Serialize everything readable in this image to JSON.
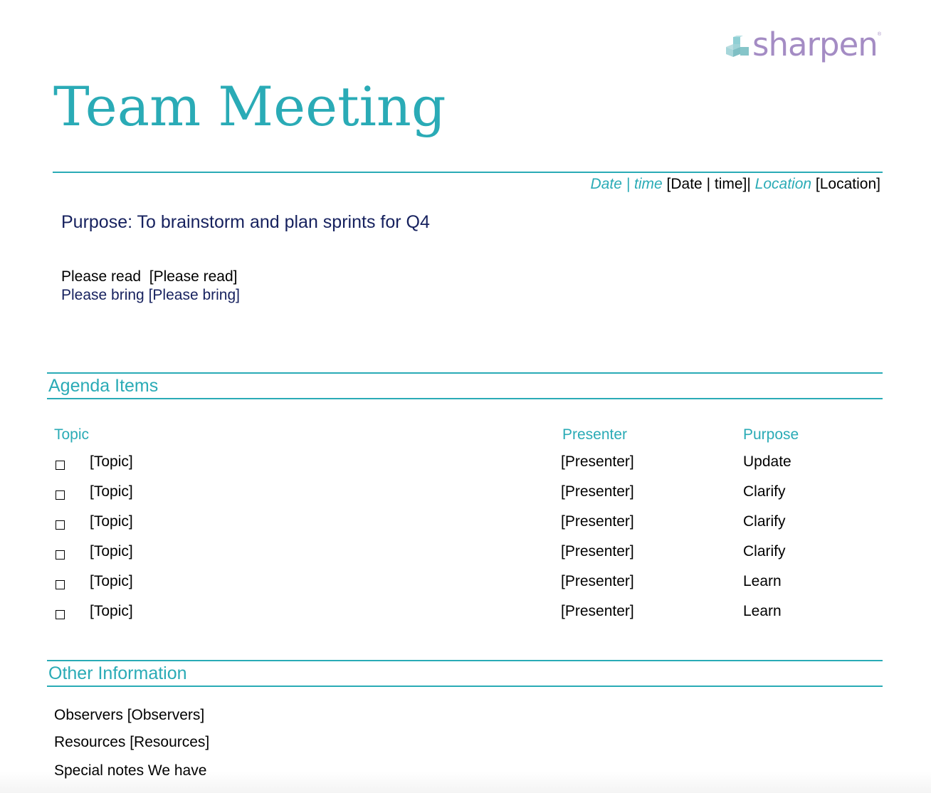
{
  "logo": {
    "name": "sharpen",
    "icon": "stacked-cubes-icon",
    "registered": "®"
  },
  "document": {
    "title": "Team Meeting",
    "meta": {
      "date_label": "Date | time",
      "date_value": "[Date | time]|",
      "location_label": "Location",
      "location_value": "[Location]"
    },
    "purpose": "Purpose: To brainstorm and plan sprints for Q4",
    "please_read": "Please read  [Please read]",
    "please_bring": "Please bring [Please bring]"
  },
  "agenda": {
    "section_title": "Agenda Items",
    "columns": {
      "topic": "Topic",
      "presenter": "Presenter",
      "purpose": "Purpose"
    },
    "items": [
      {
        "checked": false,
        "topic": "[Topic]",
        "presenter": "[Presenter]",
        "purpose": "Update"
      },
      {
        "checked": false,
        "topic": "[Topic]",
        "presenter": "[Presenter]",
        "purpose": "Clarify"
      },
      {
        "checked": false,
        "topic": "[Topic]",
        "presenter": "[Presenter]",
        "purpose": "Clarify"
      },
      {
        "checked": false,
        "topic": "[Topic]",
        "presenter": "[Presenter]",
        "purpose": "Clarify"
      },
      {
        "checked": false,
        "topic": "[Topic]",
        "presenter": "[Presenter]",
        "purpose": "Learn"
      },
      {
        "checked": false,
        "topic": "[Topic]",
        "presenter": "[Presenter]",
        "purpose": "Learn"
      }
    ]
  },
  "other": {
    "section_title": "Other Information",
    "observers": "Observers [Observers]",
    "resources": "Resources [Resources]",
    "special_notes": "Special notes We have"
  },
  "colors": {
    "accent": "#2aabb6",
    "navy": "#16215e",
    "logo_purple": "#a48cc4"
  }
}
